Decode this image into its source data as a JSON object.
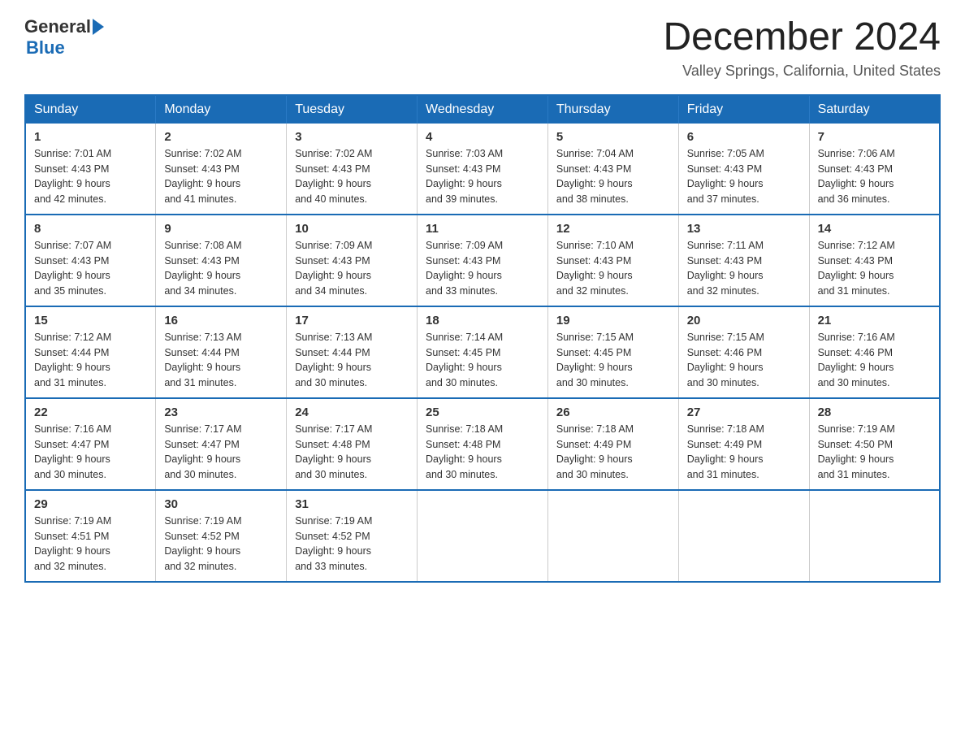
{
  "header": {
    "logo_text_general": "General",
    "logo_text_blue": "Blue",
    "month_year": "December 2024",
    "location": "Valley Springs, California, United States"
  },
  "weekdays": [
    "Sunday",
    "Monday",
    "Tuesday",
    "Wednesday",
    "Thursday",
    "Friday",
    "Saturday"
  ],
  "weeks": [
    [
      {
        "day": "1",
        "sunrise": "Sunrise: 7:01 AM",
        "sunset": "Sunset: 4:43 PM",
        "daylight": "Daylight: 9 hours and 42 minutes."
      },
      {
        "day": "2",
        "sunrise": "Sunrise: 7:02 AM",
        "sunset": "Sunset: 4:43 PM",
        "daylight": "Daylight: 9 hours and 41 minutes."
      },
      {
        "day": "3",
        "sunrise": "Sunrise: 7:02 AM",
        "sunset": "Sunset: 4:43 PM",
        "daylight": "Daylight: 9 hours and 40 minutes."
      },
      {
        "day": "4",
        "sunrise": "Sunrise: 7:03 AM",
        "sunset": "Sunset: 4:43 PM",
        "daylight": "Daylight: 9 hours and 39 minutes."
      },
      {
        "day": "5",
        "sunrise": "Sunrise: 7:04 AM",
        "sunset": "Sunset: 4:43 PM",
        "daylight": "Daylight: 9 hours and 38 minutes."
      },
      {
        "day": "6",
        "sunrise": "Sunrise: 7:05 AM",
        "sunset": "Sunset: 4:43 PM",
        "daylight": "Daylight: 9 hours and 37 minutes."
      },
      {
        "day": "7",
        "sunrise": "Sunrise: 7:06 AM",
        "sunset": "Sunset: 4:43 PM",
        "daylight": "Daylight: 9 hours and 36 minutes."
      }
    ],
    [
      {
        "day": "8",
        "sunrise": "Sunrise: 7:07 AM",
        "sunset": "Sunset: 4:43 PM",
        "daylight": "Daylight: 9 hours and 35 minutes."
      },
      {
        "day": "9",
        "sunrise": "Sunrise: 7:08 AM",
        "sunset": "Sunset: 4:43 PM",
        "daylight": "Daylight: 9 hours and 34 minutes."
      },
      {
        "day": "10",
        "sunrise": "Sunrise: 7:09 AM",
        "sunset": "Sunset: 4:43 PM",
        "daylight": "Daylight: 9 hours and 34 minutes."
      },
      {
        "day": "11",
        "sunrise": "Sunrise: 7:09 AM",
        "sunset": "Sunset: 4:43 PM",
        "daylight": "Daylight: 9 hours and 33 minutes."
      },
      {
        "day": "12",
        "sunrise": "Sunrise: 7:10 AM",
        "sunset": "Sunset: 4:43 PM",
        "daylight": "Daylight: 9 hours and 32 minutes."
      },
      {
        "day": "13",
        "sunrise": "Sunrise: 7:11 AM",
        "sunset": "Sunset: 4:43 PM",
        "daylight": "Daylight: 9 hours and 32 minutes."
      },
      {
        "day": "14",
        "sunrise": "Sunrise: 7:12 AM",
        "sunset": "Sunset: 4:43 PM",
        "daylight": "Daylight: 9 hours and 31 minutes."
      }
    ],
    [
      {
        "day": "15",
        "sunrise": "Sunrise: 7:12 AM",
        "sunset": "Sunset: 4:44 PM",
        "daylight": "Daylight: 9 hours and 31 minutes."
      },
      {
        "day": "16",
        "sunrise": "Sunrise: 7:13 AM",
        "sunset": "Sunset: 4:44 PM",
        "daylight": "Daylight: 9 hours and 31 minutes."
      },
      {
        "day": "17",
        "sunrise": "Sunrise: 7:13 AM",
        "sunset": "Sunset: 4:44 PM",
        "daylight": "Daylight: 9 hours and 30 minutes."
      },
      {
        "day": "18",
        "sunrise": "Sunrise: 7:14 AM",
        "sunset": "Sunset: 4:45 PM",
        "daylight": "Daylight: 9 hours and 30 minutes."
      },
      {
        "day": "19",
        "sunrise": "Sunrise: 7:15 AM",
        "sunset": "Sunset: 4:45 PM",
        "daylight": "Daylight: 9 hours and 30 minutes."
      },
      {
        "day": "20",
        "sunrise": "Sunrise: 7:15 AM",
        "sunset": "Sunset: 4:46 PM",
        "daylight": "Daylight: 9 hours and 30 minutes."
      },
      {
        "day": "21",
        "sunrise": "Sunrise: 7:16 AM",
        "sunset": "Sunset: 4:46 PM",
        "daylight": "Daylight: 9 hours and 30 minutes."
      }
    ],
    [
      {
        "day": "22",
        "sunrise": "Sunrise: 7:16 AM",
        "sunset": "Sunset: 4:47 PM",
        "daylight": "Daylight: 9 hours and 30 minutes."
      },
      {
        "day": "23",
        "sunrise": "Sunrise: 7:17 AM",
        "sunset": "Sunset: 4:47 PM",
        "daylight": "Daylight: 9 hours and 30 minutes."
      },
      {
        "day": "24",
        "sunrise": "Sunrise: 7:17 AM",
        "sunset": "Sunset: 4:48 PM",
        "daylight": "Daylight: 9 hours and 30 minutes."
      },
      {
        "day": "25",
        "sunrise": "Sunrise: 7:18 AM",
        "sunset": "Sunset: 4:48 PM",
        "daylight": "Daylight: 9 hours and 30 minutes."
      },
      {
        "day": "26",
        "sunrise": "Sunrise: 7:18 AM",
        "sunset": "Sunset: 4:49 PM",
        "daylight": "Daylight: 9 hours and 30 minutes."
      },
      {
        "day": "27",
        "sunrise": "Sunrise: 7:18 AM",
        "sunset": "Sunset: 4:49 PM",
        "daylight": "Daylight: 9 hours and 31 minutes."
      },
      {
        "day": "28",
        "sunrise": "Sunrise: 7:19 AM",
        "sunset": "Sunset: 4:50 PM",
        "daylight": "Daylight: 9 hours and 31 minutes."
      }
    ],
    [
      {
        "day": "29",
        "sunrise": "Sunrise: 7:19 AM",
        "sunset": "Sunset: 4:51 PM",
        "daylight": "Daylight: 9 hours and 32 minutes."
      },
      {
        "day": "30",
        "sunrise": "Sunrise: 7:19 AM",
        "sunset": "Sunset: 4:52 PM",
        "daylight": "Daylight: 9 hours and 32 minutes."
      },
      {
        "day": "31",
        "sunrise": "Sunrise: 7:19 AM",
        "sunset": "Sunset: 4:52 PM",
        "daylight": "Daylight: 9 hours and 33 minutes."
      },
      null,
      null,
      null,
      null
    ]
  ]
}
